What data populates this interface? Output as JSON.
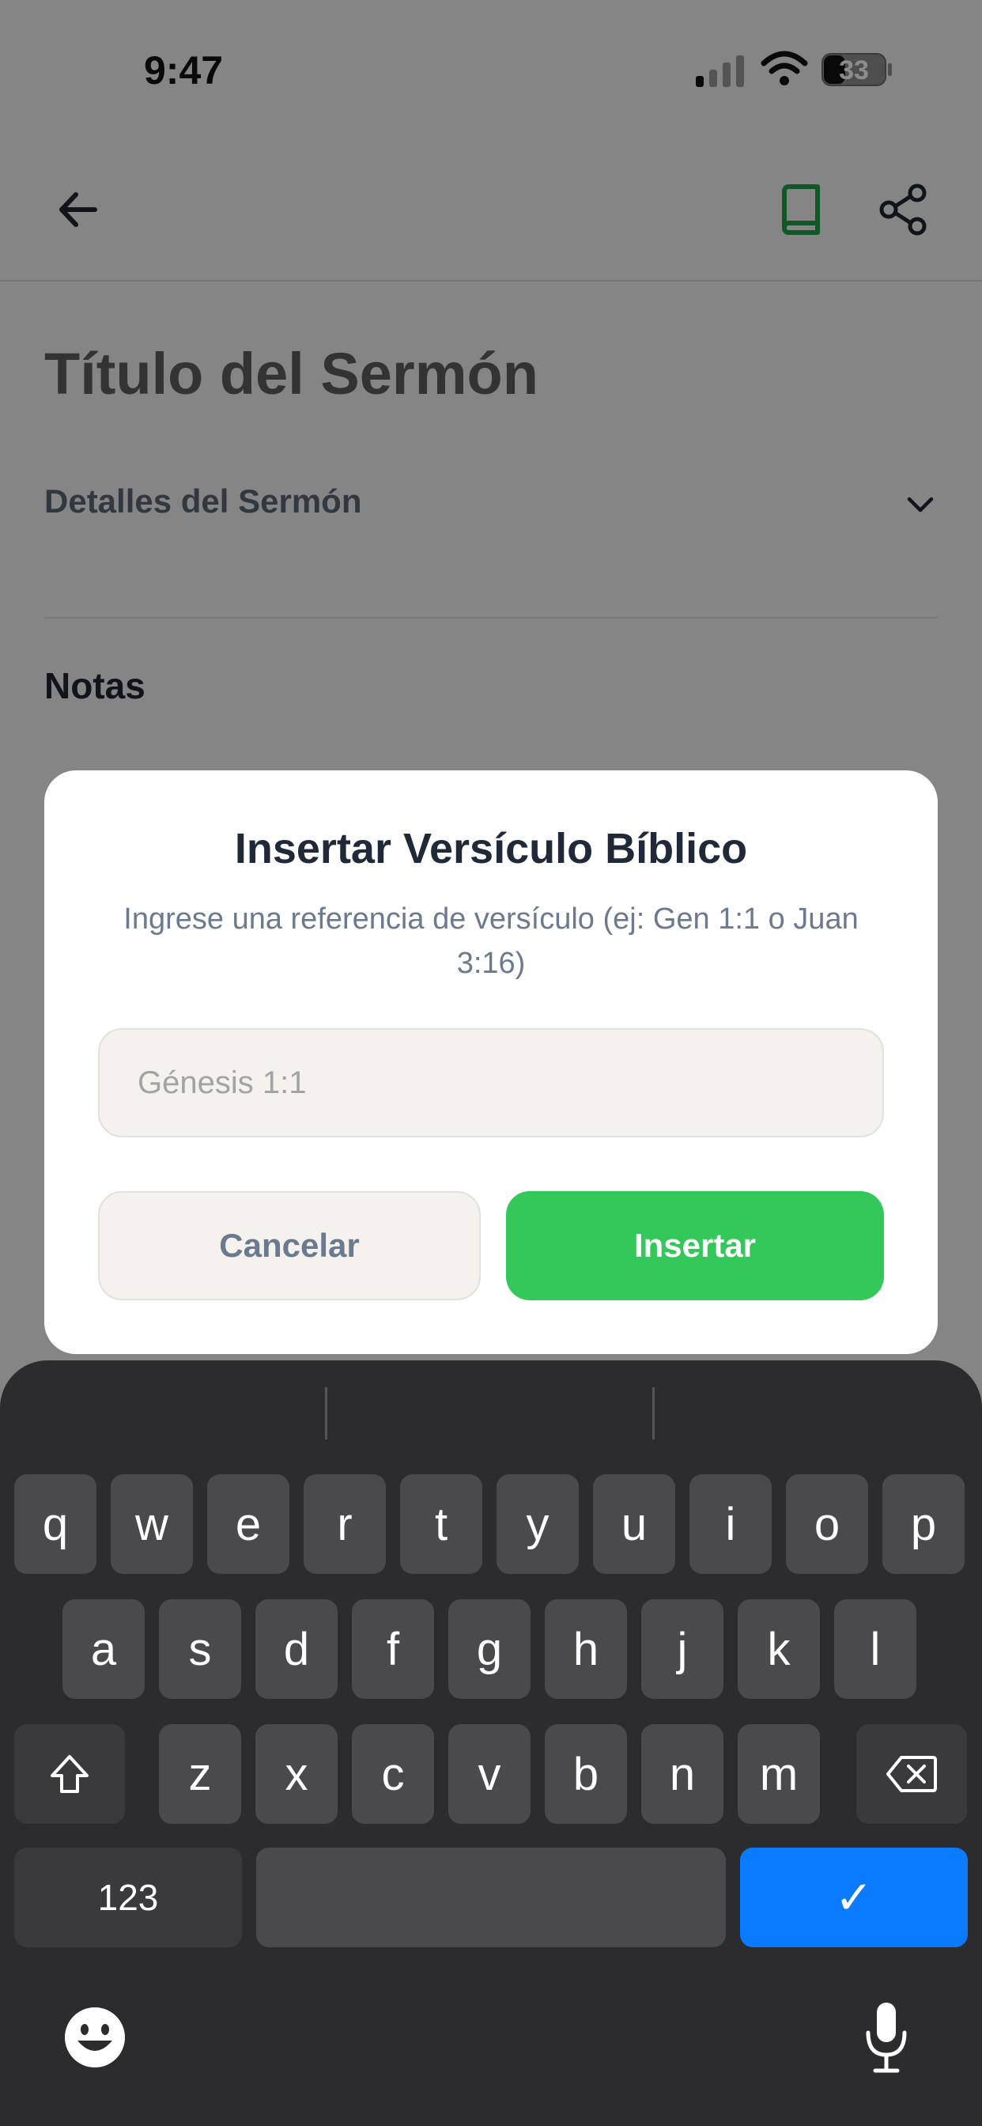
{
  "status_bar": {
    "time": "9:47",
    "battery": "33",
    "icons": [
      "signal-icon",
      "wifi-icon",
      "battery-icon"
    ]
  },
  "header": {
    "back_icon": "arrow-left-icon",
    "book_icon": "book-icon",
    "share_icon": "share-icon",
    "accent_color": "#22a046"
  },
  "sermon": {
    "title": "Título del Sermón",
    "details_label": "Detalles del Sermón",
    "notes_label": "Notas"
  },
  "dialog": {
    "title": "Insertar Versículo Bíblico",
    "subtitle": "Ingrese una referencia de versículo (ej: Gen 1:1 o Juan 3:16)",
    "input_value": "",
    "input_placeholder": "Génesis 1:1",
    "cancel_label": "Cancelar",
    "insert_label": "Insertar",
    "insert_color": "#34c759"
  },
  "keyboard": {
    "row1": [
      "q",
      "w",
      "e",
      "r",
      "t",
      "y",
      "u",
      "i",
      "o",
      "p"
    ],
    "row2": [
      "a",
      "s",
      "d",
      "f",
      "g",
      "h",
      "j",
      "k",
      "l"
    ],
    "row3": [
      "z",
      "x",
      "c",
      "v",
      "b",
      "n",
      "m"
    ],
    "numbers_label": "123",
    "done_glyph": "✓",
    "done_color": "#0a7aff",
    "icons": [
      "shift-icon",
      "backspace-icon",
      "emoji-icon",
      "microphone-icon"
    ]
  }
}
